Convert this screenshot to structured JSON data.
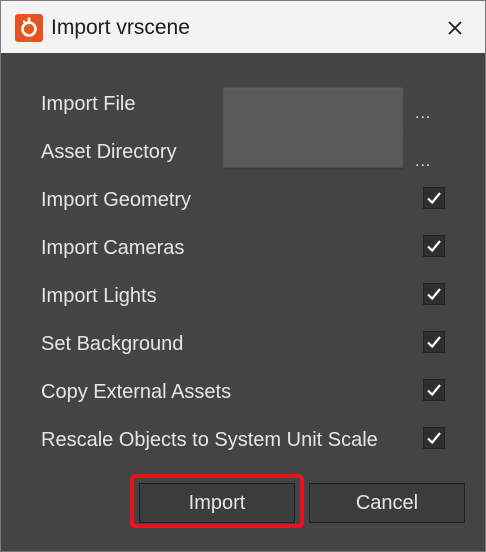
{
  "window": {
    "title": "Import vrscene",
    "icon": "vray-logo-icon",
    "close_icon": "close-icon"
  },
  "fields": [
    {
      "label": "Import File",
      "browse_label": "..."
    },
    {
      "label": "Asset Directory",
      "browse_label": "..."
    }
  ],
  "options": [
    {
      "label": "Import Geometry",
      "checked": true
    },
    {
      "label": "Import Cameras",
      "checked": true
    },
    {
      "label": "Import Lights",
      "checked": true
    },
    {
      "label": "Set Background",
      "checked": true
    },
    {
      "label": "Copy External Assets",
      "checked": true
    },
    {
      "label": "Rescale Objects to System Unit Scale",
      "checked": true
    }
  ],
  "buttons": {
    "import_label": "Import",
    "cancel_label": "Cancel"
  },
  "colors": {
    "accent_highlight": "#e8141b",
    "app_icon": "#e8541f",
    "dialog_bg": "#444444"
  }
}
